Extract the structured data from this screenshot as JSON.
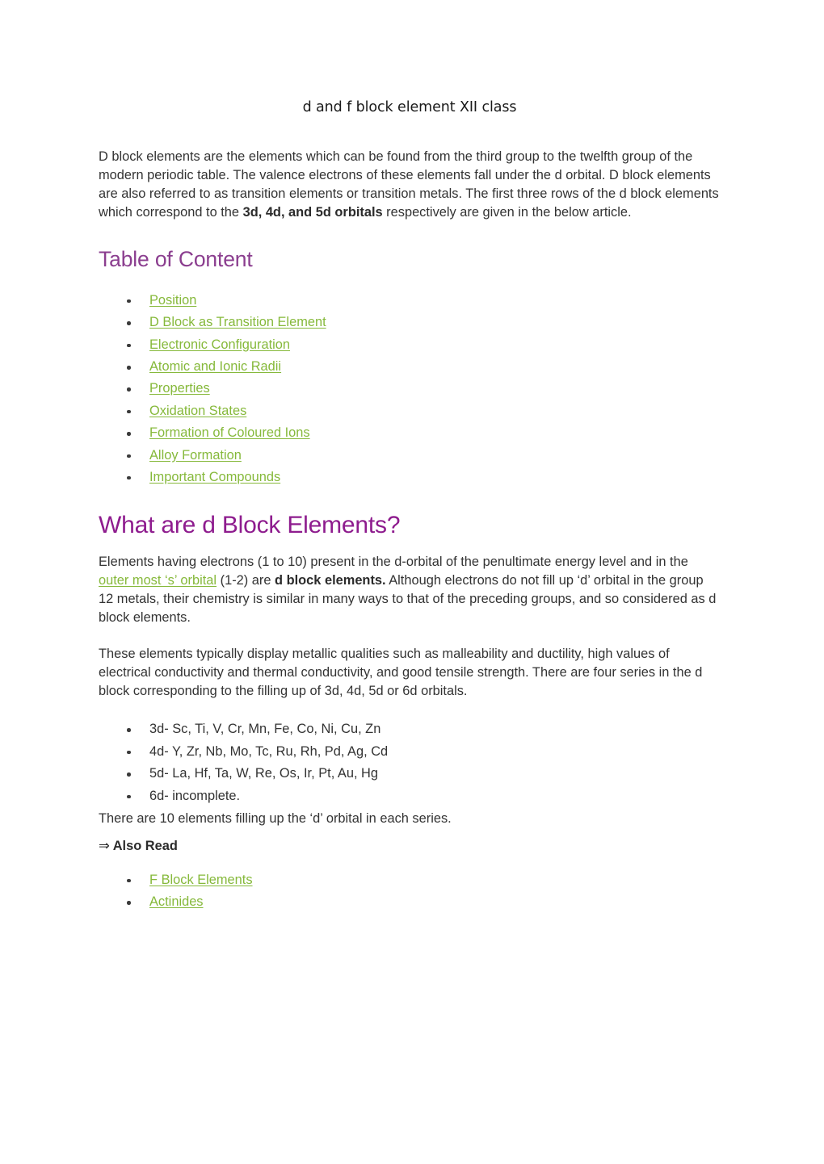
{
  "document": {
    "title": "d and f block element XII class",
    "intro_paragraph": {
      "part1": "D block elements are the elements which can be found from the third group to the twelfth group of the modern periodic table. The valence electrons of these elements fall under the d orbital. D block elements are also referred to as transition elements or transition metals. The first three rows of the d block elements which correspond to the ",
      "bold": "3d, 4d, and 5d orbitals",
      "part2": " respectively are given in the below article."
    },
    "toc": {
      "heading": "Table of Content",
      "items": [
        "Position",
        "D Block as Transition Element",
        "Electronic Configuration",
        "Atomic and Ionic Radii",
        "Properties",
        "Oxidation States",
        "Formation of Coloured Ions",
        "Alloy Formation",
        "Important Compounds"
      ]
    },
    "section": {
      "heading": "What are d Block Elements?",
      "paragraph1": {
        "part1": "Elements having electrons (1 to 10) present in the d-orbital of the penultimate energy level and in the ",
        "link": "outer most ‘s’ orbital",
        "part2": " (1-2) are ",
        "bold": "d block elements.",
        "part3": " Although electrons do not fill up ‘d’ orbital in the group 12 metals, their chemistry is similar in many ways to that of the preceding groups, and so considered as d block elements."
      },
      "paragraph2": "These elements typically display metallic qualities such as malleability and ductility, high values of electrical conductivity and thermal conductivity, and good tensile strength. There are four series in the d block corresponding to the filling up of 3d, 4d, 5d or 6d orbitals.",
      "series_list": [
        "3d- Sc, Ti, V, Cr, Mn, Fe, Co, Ni, Cu, Zn",
        "4d- Y, Zr, Nb, Mo, Tc, Ru, Rh, Pd, Ag, Cd",
        "5d- La, Hf, Ta, W, Re, Os, Ir, Pt, Au, Hg",
        "6d- incomplete."
      ],
      "closing_line": "There are 10 elements filling up the ‘d’ orbital in each series."
    },
    "also_read": {
      "arrow": "⇒",
      "label": "Also Read",
      "items": [
        "F Block Elements",
        "Actinides"
      ]
    }
  },
  "colors": {
    "heading_purple": "#8B3E8F",
    "section_purple": "#8E1C8E",
    "link_green": "#86B93B",
    "body_text": "#333333",
    "background": "#ffffff"
  }
}
